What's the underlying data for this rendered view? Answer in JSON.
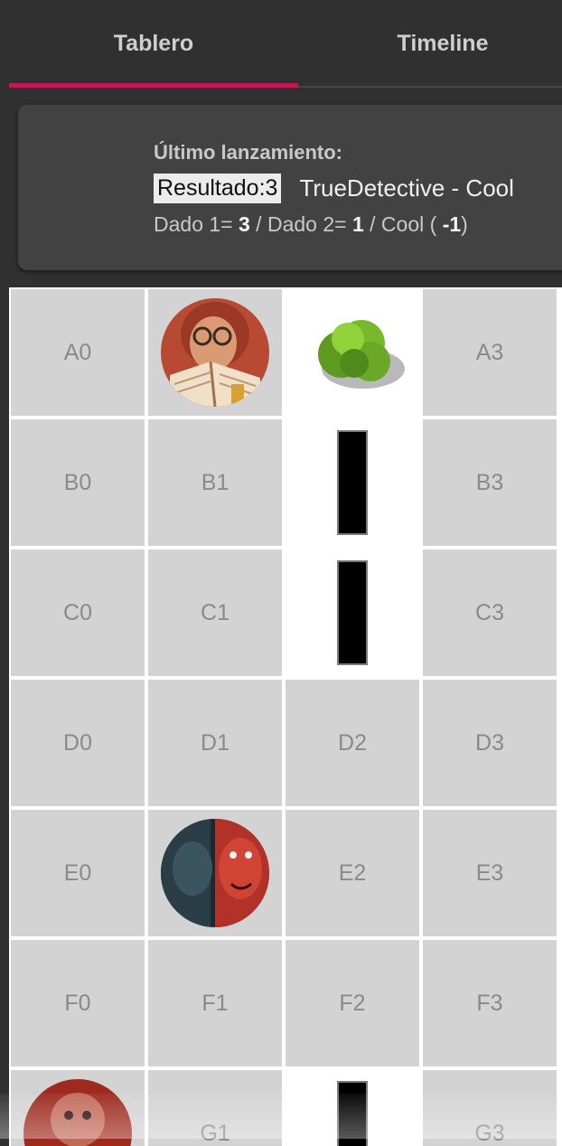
{
  "tabs": [
    {
      "label": "Tablero",
      "active": true
    },
    {
      "label": "Timeline",
      "active": false
    }
  ],
  "last_roll": {
    "title": "Último lanzamiento:",
    "result_label": "Resultado:3",
    "player": "TrueDetective - Cool",
    "dice1_prefix": "Dado 1= ",
    "dice1": "3",
    "dice2_prefix": " / Dado 2= ",
    "dice2": "1",
    "mod_prefix": " / Cool ( ",
    "mod": "-1",
    "mod_suffix": ")"
  },
  "board": {
    "rows": [
      [
        "A0",
        "",
        "",
        "A3"
      ],
      [
        "B0",
        "B1",
        "",
        "B3"
      ],
      [
        "C0",
        "C1",
        "",
        "C3"
      ],
      [
        "D0",
        "D1",
        "D2",
        "D3"
      ],
      [
        "E0",
        "",
        "E2",
        "E3"
      ],
      [
        "F0",
        "F1",
        "F2",
        "F3"
      ],
      [
        "",
        "G1",
        "",
        "G3"
      ]
    ],
    "pieces": [
      {
        "cell": "A1",
        "type": "token",
        "name": "reader-character"
      },
      {
        "cell": "A2",
        "type": "bush",
        "name": "bush"
      },
      {
        "cell": "B2",
        "type": "wall",
        "name": "wall"
      },
      {
        "cell": "C2",
        "type": "wall",
        "name": "wall"
      },
      {
        "cell": "E1",
        "type": "token",
        "name": "demon-character"
      },
      {
        "cell": "G0",
        "type": "token",
        "name": "red-creature-character"
      },
      {
        "cell": "G2",
        "type": "wall",
        "name": "wall"
      }
    ]
  },
  "colors": {
    "accent": "#c2185b",
    "background": "#303030",
    "card": "#424242",
    "cell": "#d3d3d3"
  }
}
